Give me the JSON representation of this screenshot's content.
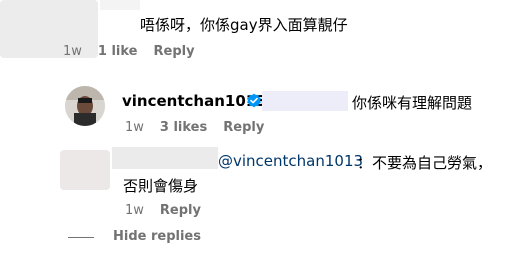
{
  "comments": [
    {
      "text": "唔係呀，你係gay界入面算靚仔",
      "time": "1w",
      "likes": "1 like",
      "reply": "Reply"
    },
    {
      "username": "vincentchan1013",
      "text": "你係咪有理解問題",
      "time": "1w",
      "likes": "3 likes",
      "reply": "Reply"
    },
    {
      "mention": "@vincentchan1013",
      "text_line1": "：不要為自己勞氣，",
      "text_line2": "否則會傷身",
      "time": "1w",
      "reply": "Reply"
    }
  ],
  "hide_replies": "Hide replies",
  "colors": {
    "accent_blue": "#0095f6",
    "mention": "#00376b",
    "muted": "#737373"
  },
  "icons": {
    "verified": "verified-badge-icon"
  }
}
